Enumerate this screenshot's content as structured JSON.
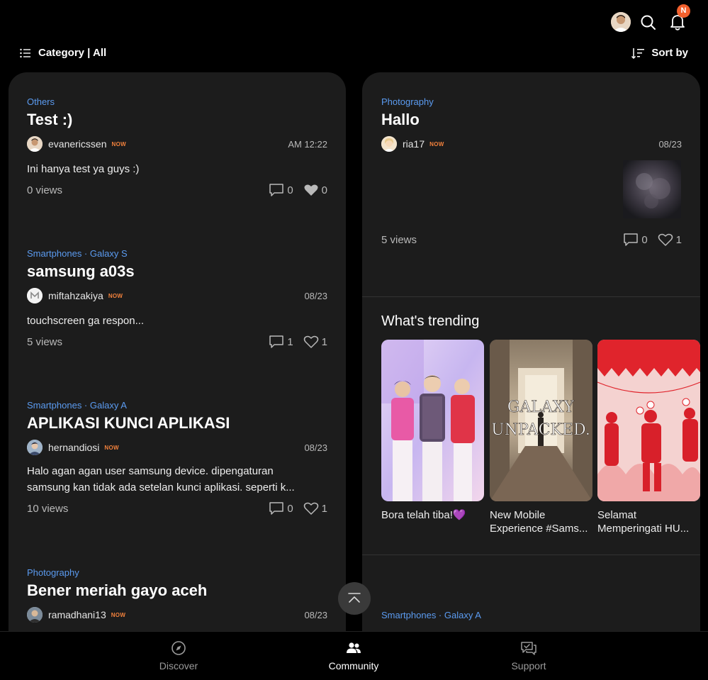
{
  "header": {
    "notification_badge": "N"
  },
  "filter": {
    "category_label": "Category | All",
    "sort_label": "Sort by"
  },
  "left_posts": [
    {
      "category": "Others",
      "title": "Test :)",
      "author": "evanericssen",
      "badge": "NOW",
      "time": "AM 12:22",
      "body": "Ini hanya test ya guys :)",
      "views": "0 views",
      "comments": "0",
      "likes": "0"
    },
    {
      "category": "Smartphones · Galaxy S",
      "title": "samsung a03s",
      "author": "miftahzakiya",
      "badge": "NOW",
      "time": "08/23",
      "body": "touchscreen ga respon...",
      "views": "5 views",
      "comments": "1",
      "likes": "1"
    },
    {
      "category": "Smartphones · Galaxy A",
      "title": "APLIKASI KUNCI APLIKASI",
      "author": "hernandiosi",
      "badge": "NOW",
      "time": "08/23",
      "body_line1": "Halo agan agan user samsung device. dipengaturan",
      "body_line2": "samsung kan tidak ada setelan kunci aplikasi. seperti k...",
      "views": "10 views",
      "comments": "0",
      "likes": "1"
    },
    {
      "category": "Photography",
      "title": "Bener meriah gayo aceh",
      "author": "ramadhani13",
      "badge": "NOW",
      "time": "08/23"
    }
  ],
  "right_post": {
    "category": "Photography",
    "title": "Hallo",
    "author": "ria17",
    "badge": "NOW",
    "time": "08/23",
    "views": "5 views",
    "comments": "0",
    "likes": "1"
  },
  "trending": {
    "title": "What's trending",
    "items": [
      {
        "label": "Bora telah tiba!💜"
      },
      {
        "label_line1": "New Mobile",
        "label_line2": "Experience #Sams...",
        "image_text_1": "GALAXY",
        "image_text_2": "UNPACKED."
      },
      {
        "label_line1": "Selamat",
        "label_line2": "Memperingati HU..."
      }
    ]
  },
  "next_post": {
    "category": "Smartphones · Galaxy A"
  },
  "bottom_nav": {
    "discover": "Discover",
    "community": "Community",
    "support": "Support"
  },
  "colors": {
    "accent_blue": "#5b9bf0",
    "now_orange": "#f2813c",
    "badge_orange": "#f2602d",
    "panel_bg": "#1c1c1c"
  }
}
